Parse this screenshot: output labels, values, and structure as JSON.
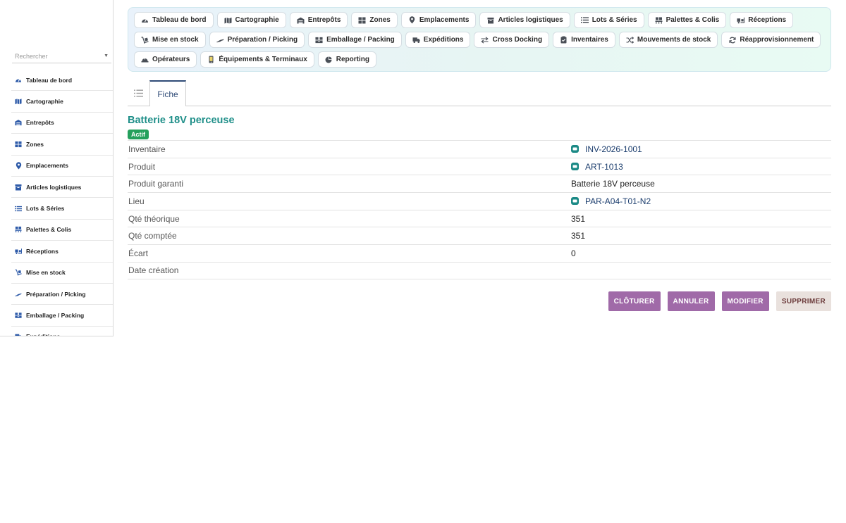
{
  "sidebar": {
    "search_placeholder": "Rechercher",
    "items": [
      {
        "label": "Tableau de bord",
        "icon": "gauge-icon"
      },
      {
        "label": "Cartographie",
        "icon": "map-icon"
      },
      {
        "label": "Entrepôts",
        "icon": "warehouse-icon"
      },
      {
        "label": "Zones",
        "icon": "grid-icon"
      },
      {
        "label": "Emplacements",
        "icon": "location-pin-icon"
      },
      {
        "label": "Articles logistiques",
        "icon": "box-icon"
      },
      {
        "label": "Lots & Séries",
        "icon": "list-icon"
      },
      {
        "label": "Palettes & Colis",
        "icon": "pallet-icon"
      },
      {
        "label": "Réceptions",
        "icon": "truck-loading-icon"
      },
      {
        "label": "Mise en stock",
        "icon": "dolly-icon"
      },
      {
        "label": "Préparation / Picking",
        "icon": "hand-icon"
      },
      {
        "label": "Emballage / Packing",
        "icon": "boxes-icon"
      },
      {
        "label": "Expéditions",
        "icon": "truck-icon"
      }
    ]
  },
  "topnav": {
    "chips": [
      {
        "label": "Tableau de bord",
        "icon": "gauge-icon"
      },
      {
        "label": "Cartographie",
        "icon": "map-icon"
      },
      {
        "label": "Entrepôts",
        "icon": "warehouse-icon"
      },
      {
        "label": "Zones",
        "icon": "grid-icon"
      },
      {
        "label": "Emplacements",
        "icon": "location-pin-icon"
      },
      {
        "label": "Articles logistiques",
        "icon": "box-icon"
      },
      {
        "label": "Lots & Séries",
        "icon": "list-icon"
      },
      {
        "label": "Palettes & Colis",
        "icon": "pallet-icon"
      },
      {
        "label": "Réceptions",
        "icon": "truck-loading-icon"
      },
      {
        "label": "Mise en stock",
        "icon": "dolly-icon"
      },
      {
        "label": "Préparation / Picking",
        "icon": "hand-icon"
      },
      {
        "label": "Emballage / Packing",
        "icon": "boxes-icon"
      },
      {
        "label": "Expéditions",
        "icon": "truck-icon"
      },
      {
        "label": "Cross Docking",
        "icon": "exchange-icon"
      },
      {
        "label": "Inventaires",
        "icon": "clipboard-check-icon"
      },
      {
        "label": "Mouvements de stock",
        "icon": "shuffle-icon"
      },
      {
        "label": "Réapprovisionnement",
        "icon": "refresh-icon"
      },
      {
        "label": "Opérateurs",
        "icon": "hard-hat-icon"
      },
      {
        "label": "Équipements & Terminaux",
        "icon": "mobile-icon"
      },
      {
        "label": "Reporting",
        "icon": "pie-chart-icon"
      }
    ]
  },
  "tabs": {
    "list_icon": "list-icon",
    "fiche_label": "Fiche"
  },
  "record": {
    "title": "Batterie 18V perceuse",
    "status": "Actif",
    "fields": [
      {
        "label": "Inventaire",
        "value": "INV-2026-1001",
        "link": true
      },
      {
        "label": "Produit",
        "value": "ART-1013",
        "link": true
      },
      {
        "label": "Produit garanti",
        "value": "Batterie 18V perceuse",
        "link": false
      },
      {
        "label": "Lieu",
        "value": "PAR-A04-T01-N2",
        "link": true
      },
      {
        "label": "Qté théorique",
        "value": "351",
        "link": false
      },
      {
        "label": "Qté comptée",
        "value": "351",
        "link": false
      },
      {
        "label": "Écart",
        "value": "0",
        "link": false
      },
      {
        "label": "Date création",
        "value": "",
        "link": false
      }
    ]
  },
  "actions": {
    "close_label": "CLÔTURER",
    "cancel_label": "ANNULER",
    "edit_label": "MODIFIER",
    "delete_label": "SUPPRIMER"
  },
  "colors": {
    "accent_teal": "#1f8f89",
    "status_green": "#24a05c",
    "button_purple": "#a06aa8",
    "button_light": "#e9e1dd",
    "tab_navy": "#2f4b77"
  }
}
